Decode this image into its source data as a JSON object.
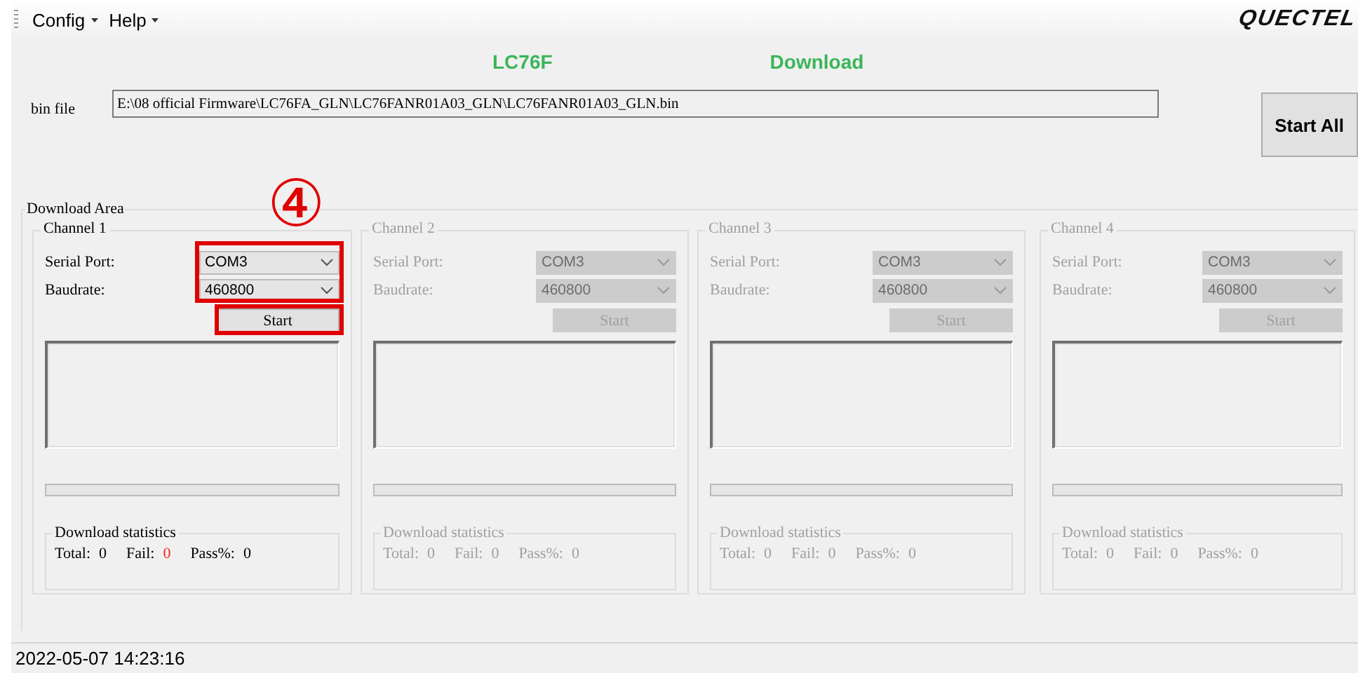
{
  "menu": [
    {
      "label": "Config"
    },
    {
      "label": "Help"
    }
  ],
  "logo": "QUECTEL",
  "header": {
    "model": "LC76F",
    "mode": "Download"
  },
  "bin_file": {
    "label": "bin file",
    "value": "E:\\08  official Firmware\\LC76FA_GLN\\LC76FANR01A03_GLN\\LC76FANR01A03_GLN.bin"
  },
  "start_all": "Start All",
  "download_area": {
    "title": "Download Area",
    "annotation": "④",
    "channels": [
      {
        "title": "Channel 1",
        "enabled": true,
        "highlighted": true,
        "serial_port_label": "Serial Port:",
        "serial_port": "COM3",
        "baudrate_label": "Baudrate:",
        "baudrate": "460800",
        "start": "Start",
        "level": 0,
        "stats_title": "Download statistics",
        "total_label": "Total:",
        "total": "0",
        "fail_label": "Fail:",
        "fail": "0",
        "pass_label": "Pass%:",
        "pass": "0"
      },
      {
        "title": "Channel 2",
        "enabled": false,
        "highlighted": false,
        "serial_port_label": "Serial Port:",
        "serial_port": "COM3",
        "baudrate_label": "Baudrate:",
        "baudrate": "460800",
        "start": "Start",
        "level": 0,
        "stats_title": "Download statistics",
        "total_label": "Total:",
        "total": "0",
        "fail_label": "Fail:",
        "fail": "0",
        "pass_label": "Pass%:",
        "pass": "0"
      },
      {
        "title": "Channel 3",
        "enabled": false,
        "highlighted": false,
        "serial_port_label": "Serial Port:",
        "serial_port": "COM3",
        "baudrate_label": "Baudrate:",
        "baudrate": "460800",
        "start": "Start",
        "level": 0,
        "stats_title": "Download statistics",
        "total_label": "Total:",
        "total": "0",
        "fail_label": "Fail:",
        "fail": "0",
        "pass_label": "Pass%:",
        "pass": "0"
      },
      {
        "title": "Channel 4",
        "enabled": false,
        "highlighted": false,
        "serial_port_label": "Serial Port:",
        "serial_port": "COM3",
        "baudrate_label": "Baudrate:",
        "baudrate": "460800",
        "start": "Start",
        "level": 0,
        "stats_title": "Download statistics",
        "total_label": "Total:",
        "total": "0",
        "fail_label": "Fail:",
        "fail": "0",
        "pass_label": "Pass%:",
        "pass": "0"
      }
    ]
  },
  "status_bar": "2022-05-07 14:23:16"
}
